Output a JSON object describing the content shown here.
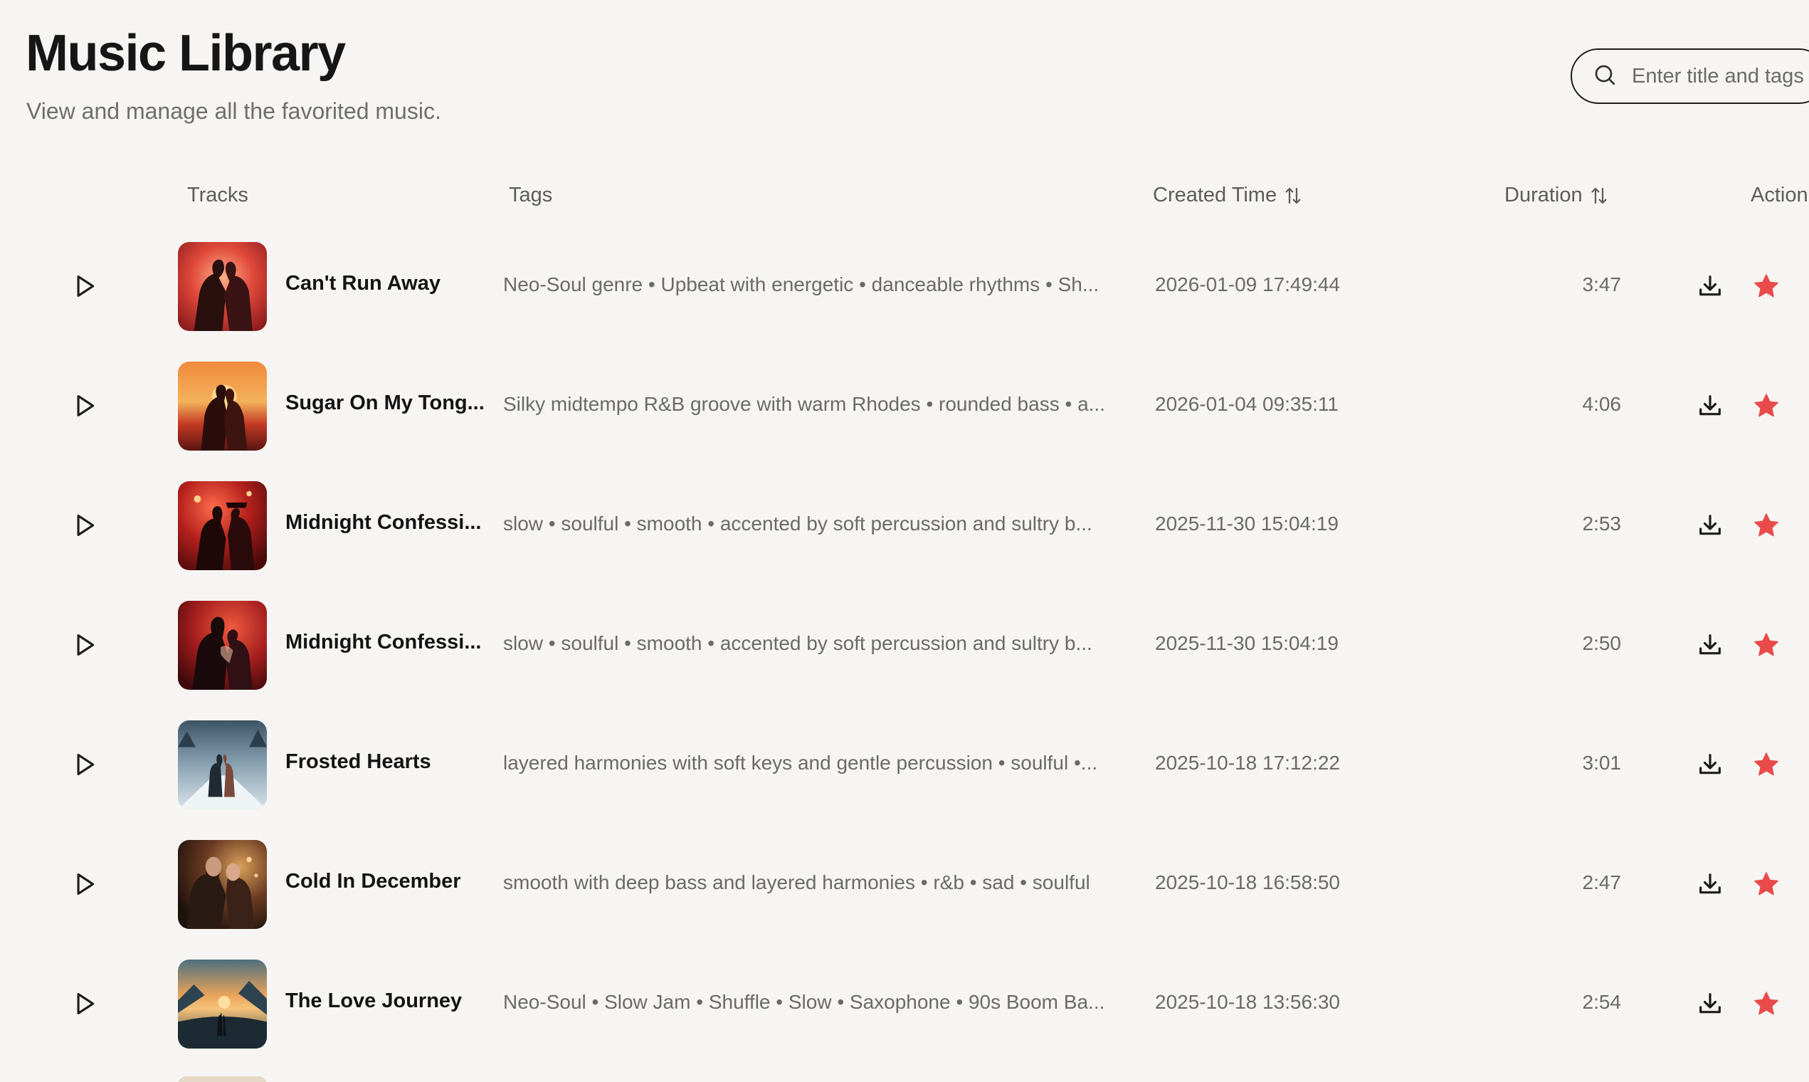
{
  "header": {
    "title": "Music Library",
    "subtitle": "View and manage all the favorited music."
  },
  "search": {
    "placeholder": "Enter title and tags",
    "value": ""
  },
  "columns": {
    "tracks": "Tracks",
    "tags": "Tags",
    "created": "Created Time",
    "duration": "Duration",
    "action": "Action"
  },
  "icons": {
    "search": "search-icon",
    "sort": "sort-icon",
    "play": "play-icon",
    "download": "download-icon",
    "favorite": "star-icon"
  },
  "colors": {
    "favorite_star": "#e94b4b",
    "background": "#f6f5f3"
  },
  "tracks": [
    {
      "title": "Can't Run Away",
      "tags": "Neo-Soul genre • Upbeat with energetic • danceable rhythms • Sh...",
      "created": "2026-01-09 17:49:44",
      "duration": "3:47",
      "favorited": true
    },
    {
      "title": "Sugar On My Tong...",
      "tags": "Silky midtempo R&B groove with warm Rhodes • rounded bass • a...",
      "created": "2026-01-04 09:35:11",
      "duration": "4:06",
      "favorited": true
    },
    {
      "title": "Midnight Confessi...",
      "tags": "slow • soulful • smooth • accented by soft percussion and sultry b...",
      "created": "2025-11-30 15:04:19",
      "duration": "2:53",
      "favorited": true
    },
    {
      "title": "Midnight Confessi...",
      "tags": "slow • soulful • smooth • accented by soft percussion and sultry b...",
      "created": "2025-11-30 15:04:19",
      "duration": "2:50",
      "favorited": true
    },
    {
      "title": "Frosted Hearts",
      "tags": "layered harmonies with soft keys and gentle percussion • soulful •...",
      "created": "2025-10-18 17:12:22",
      "duration": "3:01",
      "favorited": true
    },
    {
      "title": "Cold In December",
      "tags": "smooth with deep bass and layered harmonies • r&b • sad • soulful",
      "created": "2025-10-18 16:58:50",
      "duration": "2:47",
      "favorited": true
    },
    {
      "title": "The Love Journey",
      "tags": "Neo-Soul • Slow Jam • Shuffle • Slow • Saxophone • 90s Boom Ba...",
      "created": "2025-10-18 13:56:30",
      "duration": "2:54",
      "favorited": true
    }
  ]
}
